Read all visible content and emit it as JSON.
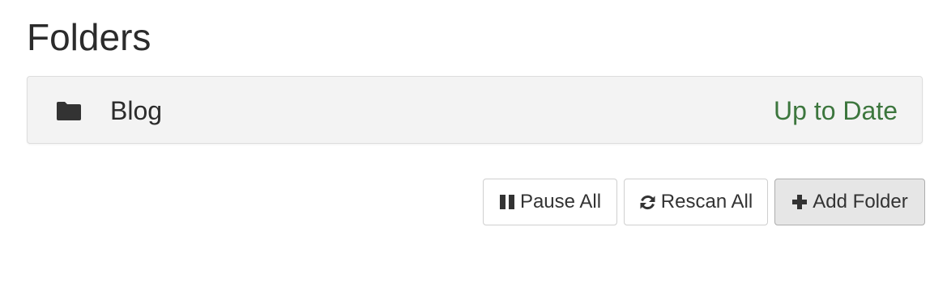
{
  "page": {
    "title": "Folders"
  },
  "folders": [
    {
      "name": "Blog",
      "status": "Up to Date",
      "icon": "folder-icon"
    }
  ],
  "actions": {
    "pause_all": {
      "label": "Pause All",
      "icon": "pause-icon"
    },
    "rescan_all": {
      "label": "Rescan All",
      "icon": "refresh-icon"
    },
    "add_folder": {
      "label": "Add Folder",
      "icon": "plus-icon"
    }
  },
  "colors": {
    "status_ok": "#3c763d",
    "panel_background": "#f3f3f3",
    "active_button_background": "#e6e6e6"
  }
}
